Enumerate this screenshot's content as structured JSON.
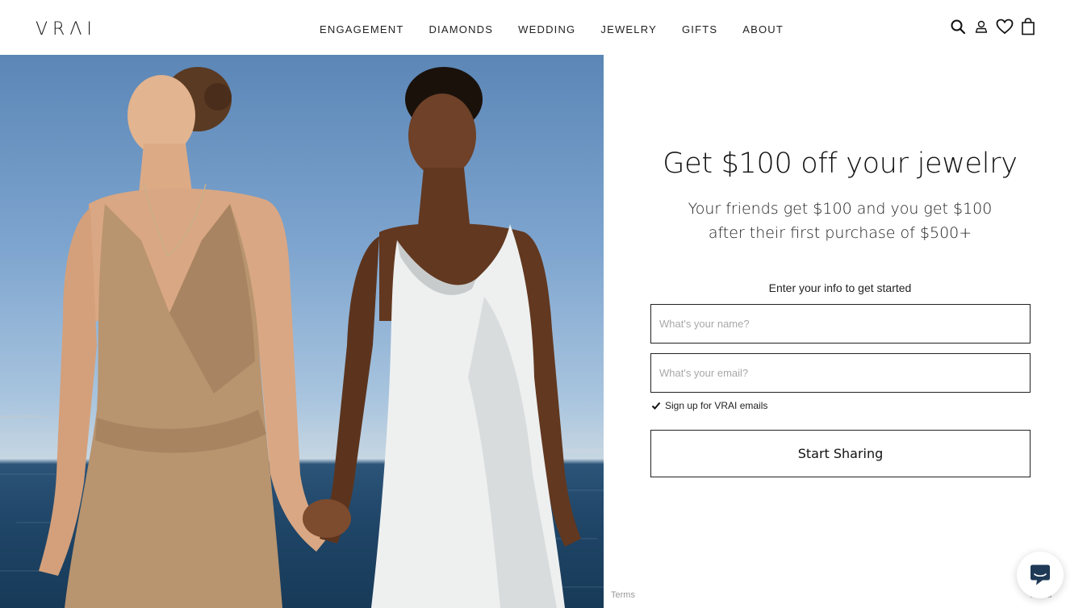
{
  "header": {
    "logo": "VRΛI",
    "nav": [
      "ENGAGEMENT",
      "DIAMONDS",
      "WEDDING",
      "JEWELRY",
      "GIFTS",
      "ABOUT"
    ],
    "icons": [
      "search-icon",
      "account-icon",
      "heart-icon",
      "bag-icon"
    ]
  },
  "hero": {
    "image": "two-models-holding-hands-by-sea"
  },
  "referral": {
    "headline": "Get $100 off your jewelry",
    "subhead_line1": "Your friends get $100 and you get $100",
    "subhead_line2": "after their first purchase of $500+",
    "prompt": "Enter your info to get started",
    "name_placeholder": "What's your name?",
    "email_placeholder": "What's your email?",
    "optin_label": "Sign up for VRAI emails",
    "optin_checked": true,
    "cta_label": "Start Sharing",
    "terms_label": "Terms",
    "powered_label": "...abu"
  },
  "colors": {
    "text": "#111111",
    "border": "#222222",
    "placeholder": "#a8a8a8",
    "chat_icon": "#1f3a56"
  }
}
